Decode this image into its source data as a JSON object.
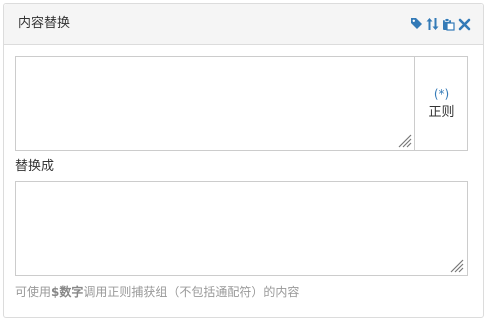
{
  "panel": {
    "title": "内容替换",
    "tools": [
      {
        "icon": "tag-icon"
      },
      {
        "icon": "sort-icon"
      },
      {
        "icon": "paste-icon"
      },
      {
        "icon": "close-icon"
      }
    ]
  },
  "find": {
    "value": "",
    "regex_mark": "(*)",
    "regex_label": "正则"
  },
  "replace": {
    "label": "替换成",
    "value": ""
  },
  "hint": {
    "prefix": "可使用",
    "emphasis": "$数字",
    "suffix": "调用正则捕获组（不包括通配符）的内容"
  },
  "colors": {
    "accent": "#337ab7",
    "header_bg": "#f5f5f5",
    "border": "#cccccc",
    "hint_text": "#999999"
  }
}
